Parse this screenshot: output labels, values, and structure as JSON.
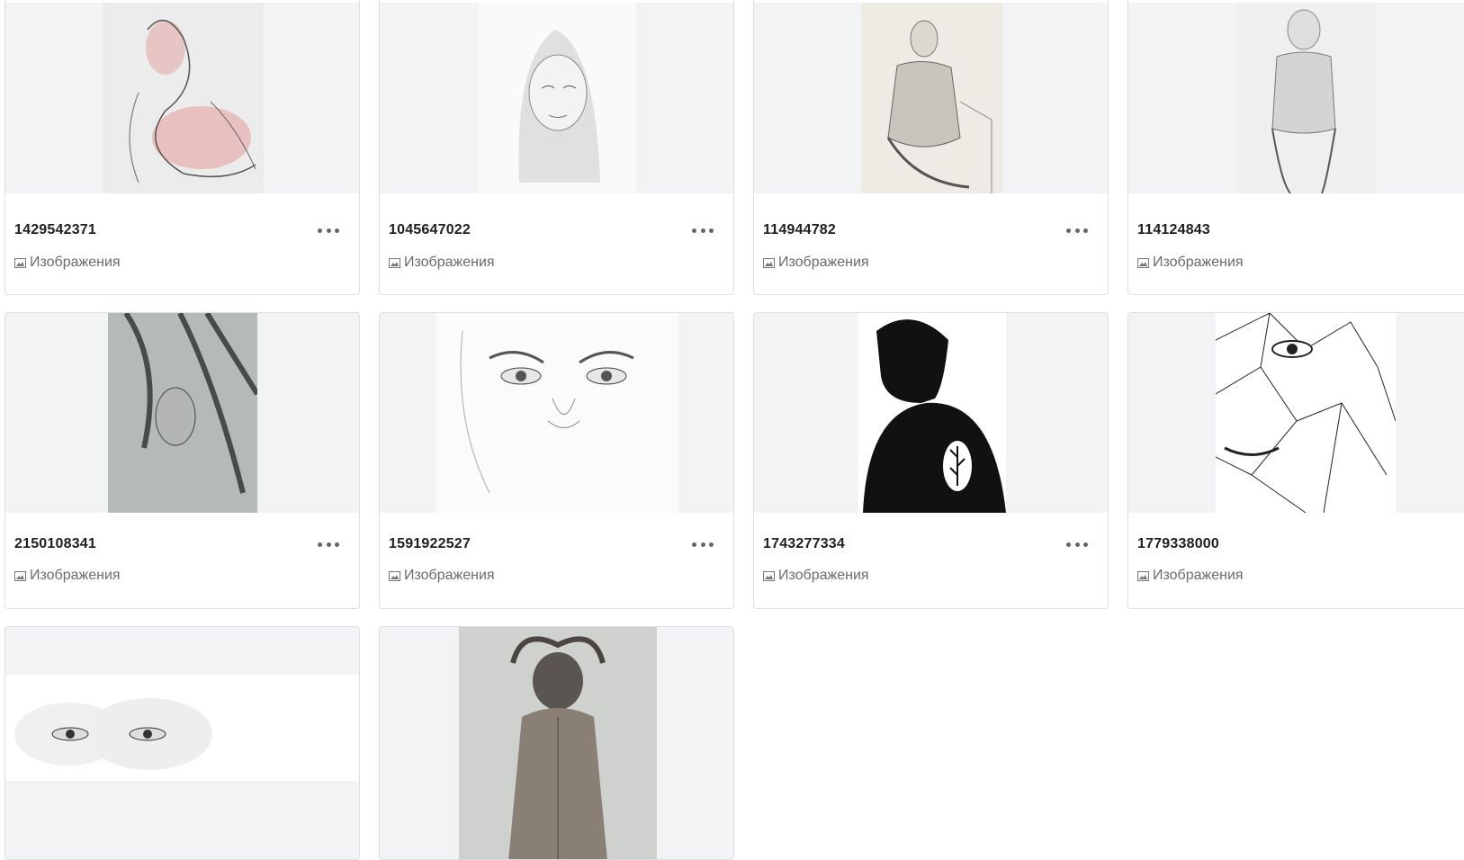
{
  "cards": [
    {
      "id": "1429542371",
      "type_label": "Изображения",
      "icon": "image-icon"
    },
    {
      "id": "1045647022",
      "type_label": "Изображения",
      "icon": "image-icon"
    },
    {
      "id": "114944782",
      "type_label": "Изображения",
      "icon": "image-icon"
    },
    {
      "id": "114124843",
      "type_label": "Изображения",
      "icon": "image-icon"
    },
    {
      "id": "2150108341",
      "type_label": "Изображения",
      "icon": "image-icon"
    },
    {
      "id": "1591922527",
      "type_label": "Изображения",
      "icon": "image-icon"
    },
    {
      "id": "1743277334",
      "type_label": "Изображения",
      "icon": "image-icon"
    },
    {
      "id": "1779338000",
      "type_label": "Изображения",
      "icon": "image-icon"
    }
  ],
  "more_icon": "more-horizontal-icon",
  "colors": {
    "card_border": "#dcdfe3",
    "thumb_bg": "#f2f3f5",
    "title": "#1f1f1f",
    "meta": "#6b6b6b"
  }
}
